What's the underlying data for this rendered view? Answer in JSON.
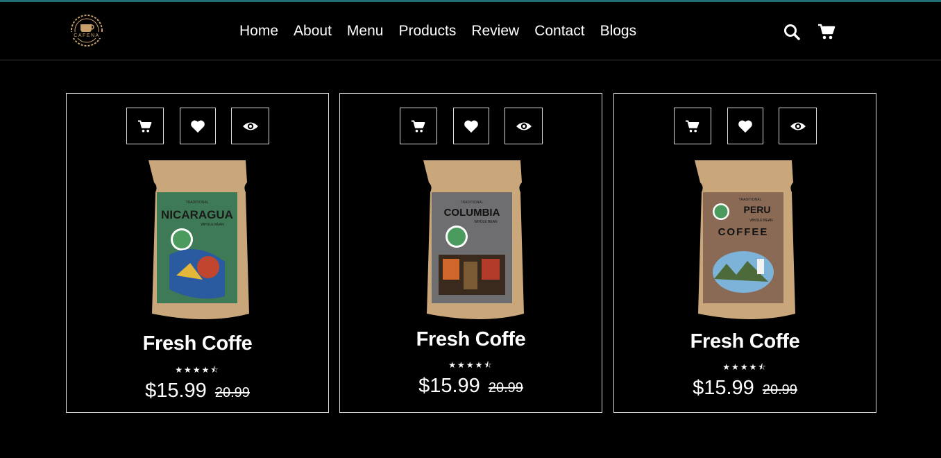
{
  "nav": {
    "logo_text": "CAFENA",
    "links": [
      "Home",
      "About",
      "Menu",
      "Products",
      "Review",
      "Contact",
      "Blogs"
    ],
    "icons": [
      "search-icon",
      "cart-icon"
    ]
  },
  "colors": {
    "accent_line": "#1f6f78",
    "background": "#000000",
    "border": "#dcdcdc"
  },
  "products": [
    {
      "title": "Fresh Coffe",
      "rating": "★★★★⯪",
      "price": "$15.99",
      "old_price": "20.99",
      "bag_label": "NICARAGUA",
      "bag_sub": "WHOLE BEAN",
      "bag_top": "TRADITIONAL"
    },
    {
      "title": "Fresh Coffe",
      "rating": "★★★★⯪",
      "price": "$15.99",
      "old_price": "20.99",
      "bag_label": "COLUMBIA",
      "bag_sub": "WHOLE BEAN",
      "bag_top": "TRADITIONAL"
    },
    {
      "title": "Fresh Coffe",
      "rating": "★★★★⯪",
      "price": "$15.99",
      "old_price": "20.99",
      "bag_label": "PERU",
      "bag_sub": "WHOLE BEAN",
      "bag_top": "TRADITIONAL",
      "bag_extra": "COFFEE"
    }
  ]
}
